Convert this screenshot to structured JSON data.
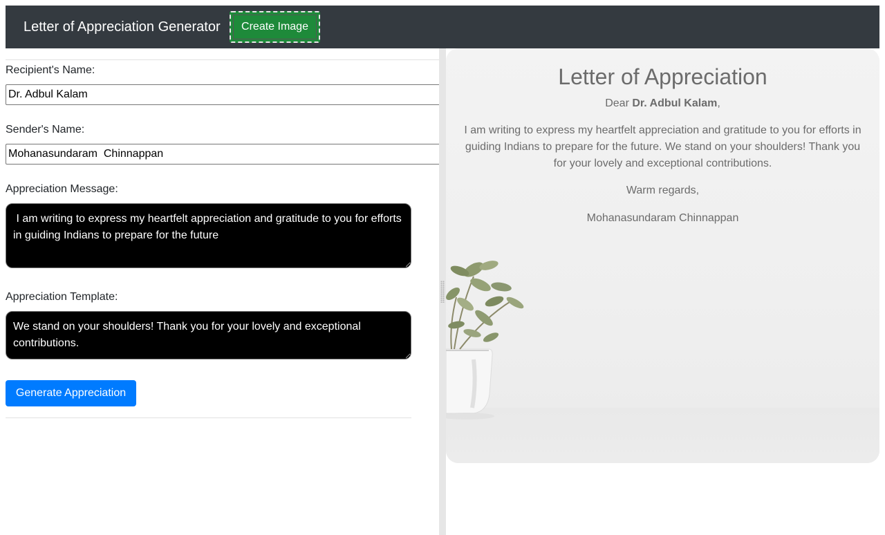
{
  "navbar": {
    "brand": "Letter of Appreciation Generator",
    "create_image_label": "Create Image"
  },
  "form": {
    "recipient_label": "Recipient's Name:",
    "recipient_value": "Dr. Adbul Kalam",
    "sender_label": "Sender's Name:",
    "sender_value": "Mohanasundaram  Chinnappan",
    "message_label": "Appreciation Message:",
    "message_value": " I am writing to express my heartfelt appreciation and gratitude to you for efforts in guiding Indians to prepare for the future",
    "template_label": "Appreciation Template:",
    "template_value": "We stand on your shoulders! Thank you for your lovely and exceptional contributions.",
    "generate_label": "Generate Appreciation"
  },
  "preview": {
    "title": "Letter of Appreciation",
    "greeting_prefix": "Dear ",
    "recipient": "Dr. Adbul Kalam",
    "greeting_suffix": ",",
    "body": "I am writing to express my heartfelt appreciation and gratitude to you for efforts in guiding Indians to prepare for the future. We stand on your shoulders! Thank you for your lovely and exceptional contributions.",
    "closing": "Warm regards,",
    "signature": "Mohanasundaram Chinnappan"
  },
  "colors": {
    "navbar_bg": "#343a40",
    "create_button": "#1e8a3a",
    "generate_button": "#007bff",
    "textarea_bg": "#000000",
    "preview_text": "#6b6b6b"
  }
}
